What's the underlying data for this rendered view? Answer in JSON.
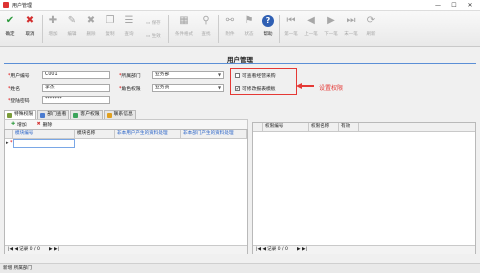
{
  "window": {
    "title": "用户管理",
    "min": "—",
    "max": "☐",
    "close": "✕"
  },
  "toolbar": {
    "buttons": [
      {
        "label": "确定",
        "icon": "check-icon",
        "glyph": "✔",
        "color": "#2e9a3e"
      },
      {
        "label": "取消",
        "icon": "cancel-icon",
        "glyph": "✖",
        "color": "#d32f2f"
      },
      {
        "label": "增加",
        "icon": "add-icon",
        "glyph": "✚",
        "color": "#a7a7a7"
      },
      {
        "label": "编辑",
        "icon": "edit-icon",
        "glyph": "✎",
        "color": "#a7a7a7"
      },
      {
        "label": "删除",
        "icon": "delete-icon",
        "glyph": "✖",
        "color": "#a7a7a7"
      },
      {
        "label": "复制",
        "icon": "copy-icon",
        "glyph": "❐",
        "color": "#a7a7a7"
      },
      {
        "label": "查询",
        "icon": "query-icon",
        "glyph": "☰",
        "color": "#a7a7a7"
      },
      {
        "label": "条件格式",
        "icon": "conditional-format-icon",
        "glyph": "▦",
        "color": "#a7a7a7"
      },
      {
        "label": "查找",
        "icon": "find-icon",
        "glyph": "⚲",
        "color": "#a7a7a7"
      },
      {
        "label": "附件",
        "icon": "attachment-icon",
        "glyph": "⚯",
        "color": "#a7a7a7"
      },
      {
        "label": "状态",
        "icon": "status-icon",
        "glyph": "⚑",
        "color": "#a7a7a7"
      },
      {
        "label": "帮助",
        "icon": "help-icon",
        "glyph": "?",
        "color": "#2f5fb3"
      },
      {
        "label": "第一笔",
        "icon": "first-record-icon",
        "glyph": "⏮",
        "color": "#a7a7a7"
      },
      {
        "label": "上一笔",
        "icon": "prev-record-icon",
        "glyph": "◀",
        "color": "#a7a7a7"
      },
      {
        "label": "下一笔",
        "icon": "next-record-icon",
        "glyph": "▶",
        "color": "#a7a7a7"
      },
      {
        "label": "末一笔",
        "icon": "last-record-icon",
        "glyph": "⏭",
        "color": "#a7a7a7"
      },
      {
        "label": "刷新",
        "icon": "refresh-icon",
        "glyph": "⟳",
        "color": "#a7a7a7"
      }
    ],
    "save_label": "保存",
    "generate_label": "生效"
  },
  "page": {
    "heading": "用户管理"
  },
  "form": {
    "user_code_label": "用户编号",
    "user_code_value": "C001",
    "name_label": "姓名",
    "name_value": "李杰",
    "password_label": "登陆密码",
    "password_value": "*******",
    "dept_label": "所属部门",
    "dept_value": "业务部",
    "role_label": "角色权限",
    "role_value": "业务员",
    "check_view_all": "可查看经营采购",
    "check_view_report": "可修改报表模板",
    "check_view_report_checked": "✔"
  },
  "callout": {
    "text": "设置权限"
  },
  "tabs": [
    {
      "label": "特殊权限"
    },
    {
      "label": "部门查看"
    },
    {
      "label": "客户权限"
    },
    {
      "label": "联系信息"
    }
  ],
  "left_grid": {
    "add_label": "增加",
    "delete_label": "删除",
    "columns": [
      "模块编号",
      "模块名称",
      "非本用户产生的资料处理",
      "非本部门产生的资料处理"
    ],
    "row_marker": "▸",
    "row_star": "*",
    "record_text": "记录 0 / 0"
  },
  "right_grid": {
    "columns": [
      "权限编号",
      "权限名称",
      "有效"
    ],
    "record_text": "记录 0 / 0"
  },
  "status_bar": {
    "text": "新增  所属部门"
  }
}
